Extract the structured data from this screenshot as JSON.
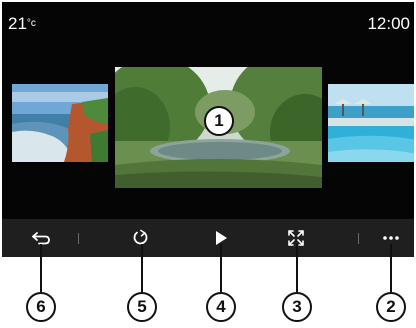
{
  "status": {
    "temperature": "21",
    "temperature_unit": "°c",
    "time": "12:00"
  },
  "gallery": {
    "images": [
      {
        "icon": "coast-photo"
      },
      {
        "icon": "garden-pond-photo"
      },
      {
        "icon": "pool-sea-photo"
      }
    ]
  },
  "callouts": {
    "main_image": "1",
    "back": "6",
    "rotate": "5",
    "play": "4",
    "fullscreen": "3",
    "more": "2"
  },
  "controls": {
    "back_icon": "back-arrow-icon",
    "rotate_icon": "rotate-icon",
    "play_icon": "play-icon",
    "fullscreen_icon": "fullscreen-icon",
    "more_icon": "more-options-icon"
  },
  "colors": {
    "screen_bg": "#050505",
    "control_bar_bg": "#1f1f1f",
    "icon": "#ffffff"
  }
}
